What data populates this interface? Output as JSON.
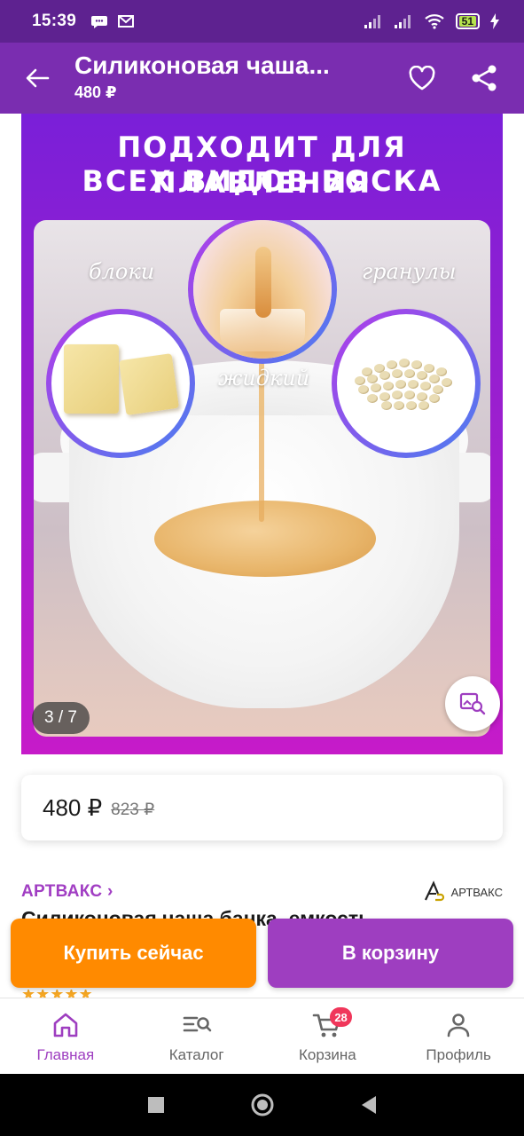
{
  "status_bar": {
    "time": "15:39",
    "battery": "51",
    "left_icons": [
      "chat-bubble-icon",
      "gmail-icon"
    ],
    "right_icons": [
      "signal-icon",
      "signal-icon",
      "wifi-icon",
      "battery-icon",
      "charging-icon"
    ]
  },
  "app_bar": {
    "title": "Силиконовая чаша...",
    "price": "480 ₽",
    "color": "#7a2db0"
  },
  "product_image": {
    "headline_line1": "ПОДХОДИТ ДЛЯ ПЛАВЛЕНИЯ",
    "headline_line2": "ВСЕХ ВИДОВ ВОСКА",
    "label_blocks": "блоки",
    "label_liquid": "жидкий",
    "label_granules": "гранулы",
    "page_indicator": "3 / 7"
  },
  "price_card": {
    "current": "480 ₽",
    "old": "823 ₽"
  },
  "brand": {
    "link": "АРТВАКС ›",
    "logo_text": "АРТВАКС"
  },
  "product_title": "Силиконовая чаша банка, емкость",
  "buttons": {
    "buy_now": "Купить сейчас",
    "add_to_cart": "В корзину",
    "buy_color": "#ff8a00",
    "cart_color": "#9e3ec0"
  },
  "bottom_nav": {
    "items": [
      {
        "label": "Главная",
        "icon": "home-icon",
        "active": true
      },
      {
        "label": "Каталог",
        "icon": "catalog-search-icon",
        "active": false
      },
      {
        "label": "Корзина",
        "icon": "cart-icon",
        "active": false
      },
      {
        "label": "Профиль",
        "icon": "profile-icon",
        "active": false
      }
    ],
    "cart_badge": "28"
  }
}
